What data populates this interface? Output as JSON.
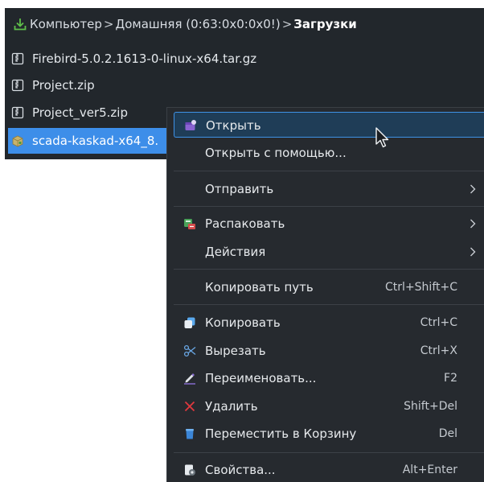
{
  "breadcrumb": {
    "parts": [
      "Компьютер",
      "Домашняя (0:63:0x0:0x0!)",
      "Загрузки"
    ],
    "separator": ">"
  },
  "files": [
    {
      "name": "Firebird-5.0.2.1613-0-linux-x64.tar.gz",
      "icon": "archive-icon"
    },
    {
      "name": "Project.zip",
      "icon": "archive-icon"
    },
    {
      "name": "Project_ver5.zip",
      "icon": "archive-icon"
    },
    {
      "name": "scada-kaskad-x64_8.",
      "icon": "package-icon",
      "selected": true
    }
  ],
  "menu": {
    "items": [
      {
        "label": "Открыть",
        "shortcut": "",
        "submenu": false,
        "icon": "open-icon",
        "highlighted": true
      },
      {
        "label": "Открыть с помощью...",
        "shortcut": "",
        "submenu": false,
        "icon": ""
      },
      {
        "label": "Отправить",
        "shortcut": "",
        "submenu": true,
        "icon": ""
      },
      {
        "label": "Распаковать",
        "shortcut": "",
        "submenu": true,
        "icon": "extract-icon"
      },
      {
        "label": "Действия",
        "shortcut": "",
        "submenu": true,
        "icon": ""
      },
      {
        "label": "Копировать путь",
        "shortcut": "Ctrl+Shift+C",
        "submenu": false,
        "icon": ""
      },
      {
        "label": "Копировать",
        "shortcut": "Ctrl+C",
        "submenu": false,
        "icon": "copy-icon"
      },
      {
        "label": "Вырезать",
        "shortcut": "Ctrl+X",
        "submenu": false,
        "icon": "scissors-icon"
      },
      {
        "label": "Переименовать...",
        "shortcut": "F2",
        "submenu": false,
        "icon": "rename-icon"
      },
      {
        "label": "Удалить",
        "shortcut": "Shift+Del",
        "submenu": false,
        "icon": "delete-icon"
      },
      {
        "label": "Переместить в Корзину",
        "shortcut": "Del",
        "submenu": false,
        "icon": "trash-icon"
      },
      {
        "label": "Свойства...",
        "shortcut": "Alt+Enter",
        "submenu": false,
        "icon": "properties-icon"
      }
    ]
  },
  "colors": {
    "panel_bg": "#22272c",
    "menu_bg": "#262a2f",
    "selection": "#3d8ee9",
    "menu_highlight_border": "#3f92e6",
    "delete_red": "#e0393e"
  }
}
